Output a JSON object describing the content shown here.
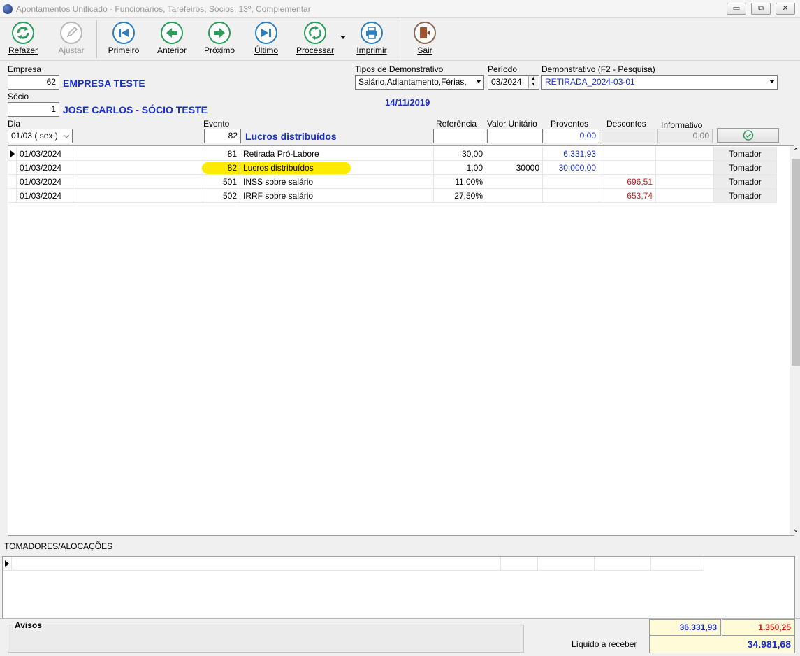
{
  "window": {
    "title": "Apontamentos Unificado - Funcionários, Tarefeiros, Sócios, 13º, Complementar",
    "buttons": [
      "▭",
      "⧉",
      "✕"
    ]
  },
  "toolbar": {
    "refazer": "Refazer",
    "ajustar": "Ajustar",
    "primeiro": "Primeiro",
    "anterior": "Anterior",
    "proximo": "Próximo",
    "ultimo": "Último",
    "processar": "Processar",
    "imprimir": "Imprimir",
    "sair": "Sair"
  },
  "form": {
    "empresa_label": "Empresa",
    "empresa_code": "62",
    "empresa_name": "EMPRESA TESTE",
    "socio_label": "Sócio",
    "socio_code": "1",
    "socio_name": "JOSE CARLOS - SÓCIO TESTE",
    "tipos_label": "Tipos de Demonstrativo",
    "tipos_value": "Salário,Adiantamento,Férias,",
    "periodo_label": "Período",
    "periodo_value": "03/2024",
    "demonstrativo_label": "Demonstrativo (F2 - Pesquisa)",
    "demonstrativo_value": "RETIRADA_2024-03-01",
    "date": "14/11/2019",
    "dia_label": "Dia",
    "dia_value": "01/03 ( sex )",
    "evento_label": "Evento",
    "evento_code": "82",
    "evento_name": "Lucros distribuídos",
    "referencia_label": "Referência",
    "valor_unitario_label": "Valor Unitário",
    "proventos_label": "Proventos",
    "proventos_value": "0,00",
    "descontos_label": "Descontos",
    "informativo_label": "Informativo",
    "informativo_value": "0,00"
  },
  "grid": {
    "rows": [
      {
        "date": "01/03/2024",
        "code": "81",
        "desc": "Retirada Pró-Labore",
        "ref": "30,00",
        "unit": "",
        "prov": "6.331,93",
        "desc_val": "",
        "tomador": "Tomador"
      },
      {
        "date": "01/03/2024",
        "code": "82",
        "desc": "Lucros distribuídos",
        "ref": "1,00",
        "unit": "30000",
        "prov": "30.000,00",
        "desc_val": "",
        "tomador": "Tomador"
      },
      {
        "date": "01/03/2024",
        "code": "501",
        "desc": "INSS sobre salário",
        "ref": "11,00%",
        "unit": "",
        "prov": "",
        "desc_val": "696,51",
        "tomador": "Tomador"
      },
      {
        "date": "01/03/2024",
        "code": "502",
        "desc": "IRRF sobre salário",
        "ref": "27,50%",
        "unit": "",
        "prov": "",
        "desc_val": "653,74",
        "tomador": "Tomador"
      }
    ]
  },
  "tomadores": {
    "title": "TOMADORES/ALOCAÇÕES"
  },
  "footer": {
    "avisos_label": "Avisos",
    "total_proventos": "36.331,93",
    "total_descontos": "1.350,25",
    "liquido_label": "Líquido a receber",
    "liquido_value": "34.981,68"
  },
  "colors": {
    "accent_blue": "#1a2fc9",
    "negative_red": "#d01a1a",
    "highlight": "#ffeb00"
  }
}
